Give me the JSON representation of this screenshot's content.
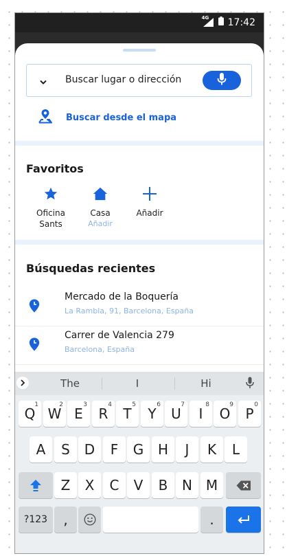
{
  "status": {
    "network": "4G",
    "time": "17:42"
  },
  "search": {
    "placeholder": "Buscar lugar o dirección",
    "map_label": "Buscar desde el mapa"
  },
  "favorites": {
    "title": "Favoritos",
    "items": [
      {
        "icon": "star-icon",
        "name": "Oficina Sants",
        "sub": ""
      },
      {
        "icon": "home-icon",
        "name": "Casa",
        "sub": "Añadir"
      },
      {
        "icon": "plus-icon",
        "name": "Añadir",
        "sub": ""
      }
    ]
  },
  "recent": {
    "title": "Búsquedas recientes",
    "items": [
      {
        "title": "Mercado de la Boquería",
        "subtitle": "La Rambla, 91, Barcelona, España"
      },
      {
        "title": "Carrer de Valencia 279",
        "subtitle": "Barcelona, España"
      }
    ]
  },
  "keyboard": {
    "suggestions": [
      "The",
      "I",
      "Hi"
    ],
    "row1": [
      "Q",
      "W",
      "E",
      "R",
      "T",
      "Y",
      "U",
      "I",
      "O",
      "P"
    ],
    "row1_nums": [
      "1",
      "2",
      "3",
      "4",
      "5",
      "6",
      "7",
      "8",
      "9",
      "0"
    ],
    "row2": [
      "A",
      "S",
      "D",
      "F",
      "G",
      "H",
      "J",
      "K",
      "L"
    ],
    "row3": [
      "Z",
      "X",
      "C",
      "V",
      "B",
      "N",
      "M"
    ],
    "symbols_key": "?123",
    "comma": ",",
    "period": "."
  },
  "colors": {
    "accent": "#1863dc",
    "light_accent": "#8db3ea",
    "divider": "#e9f1fc"
  }
}
